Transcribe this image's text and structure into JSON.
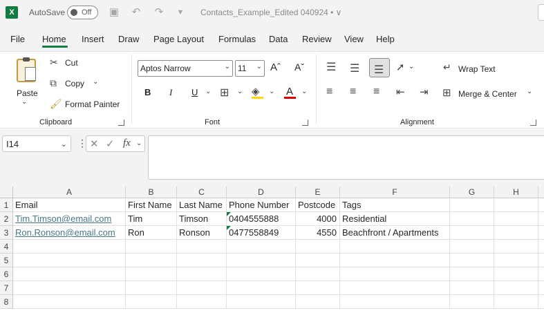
{
  "titlebar": {
    "app_logo": "X",
    "autosave_label": "AutoSave",
    "autosave_state": "Off",
    "doc_title": "Contacts_Example_Edited 040924 • ∨"
  },
  "menu": {
    "tabs": [
      "File",
      "Home",
      "Insert",
      "Draw",
      "Page Layout",
      "Formulas",
      "Data",
      "Review",
      "View",
      "Help"
    ],
    "active": "Home"
  },
  "ribbon": {
    "clipboard": {
      "paste": "Paste",
      "cut": "Cut",
      "copy": "Copy",
      "format_painter": "Format Painter",
      "label": "Clipboard"
    },
    "font": {
      "font_name": "Aptos Narrow",
      "font_size": "11",
      "bold": "B",
      "italic": "I",
      "underline": "U",
      "grow": "Aˆ",
      "shrink": "Aˇ",
      "font_color_glyph": "A",
      "label": "Font"
    },
    "alignment": {
      "wrap_text": "Wrap Text",
      "merge_center": "Merge & Center",
      "label": "Alignment"
    }
  },
  "formula_bar": {
    "name_box": "I14",
    "fx": "fx",
    "content": ""
  },
  "sheet": {
    "columns": [
      "A",
      "B",
      "C",
      "D",
      "E",
      "F",
      "G",
      "H"
    ],
    "rows": [
      "1",
      "2",
      "3",
      "4",
      "5",
      "6",
      "7",
      "8"
    ],
    "header": [
      "Email",
      "First Name",
      "Last Name",
      "Phone Number",
      "Postcode",
      "Tags"
    ],
    "data": [
      [
        "Tim.Timson@email.com",
        "Tim",
        "Timson",
        "0404555888",
        "4000",
        "Residential"
      ],
      [
        "Ron.Ronson@email.com",
        "Ron",
        "Ronson",
        "0477558849",
        "4550",
        "Beachfront / Apartments"
      ]
    ]
  },
  "colors": {
    "excel_green": "#107c41",
    "link": "#467886",
    "highlight_yellow": "#ffd700",
    "font_red": "#e00000"
  }
}
